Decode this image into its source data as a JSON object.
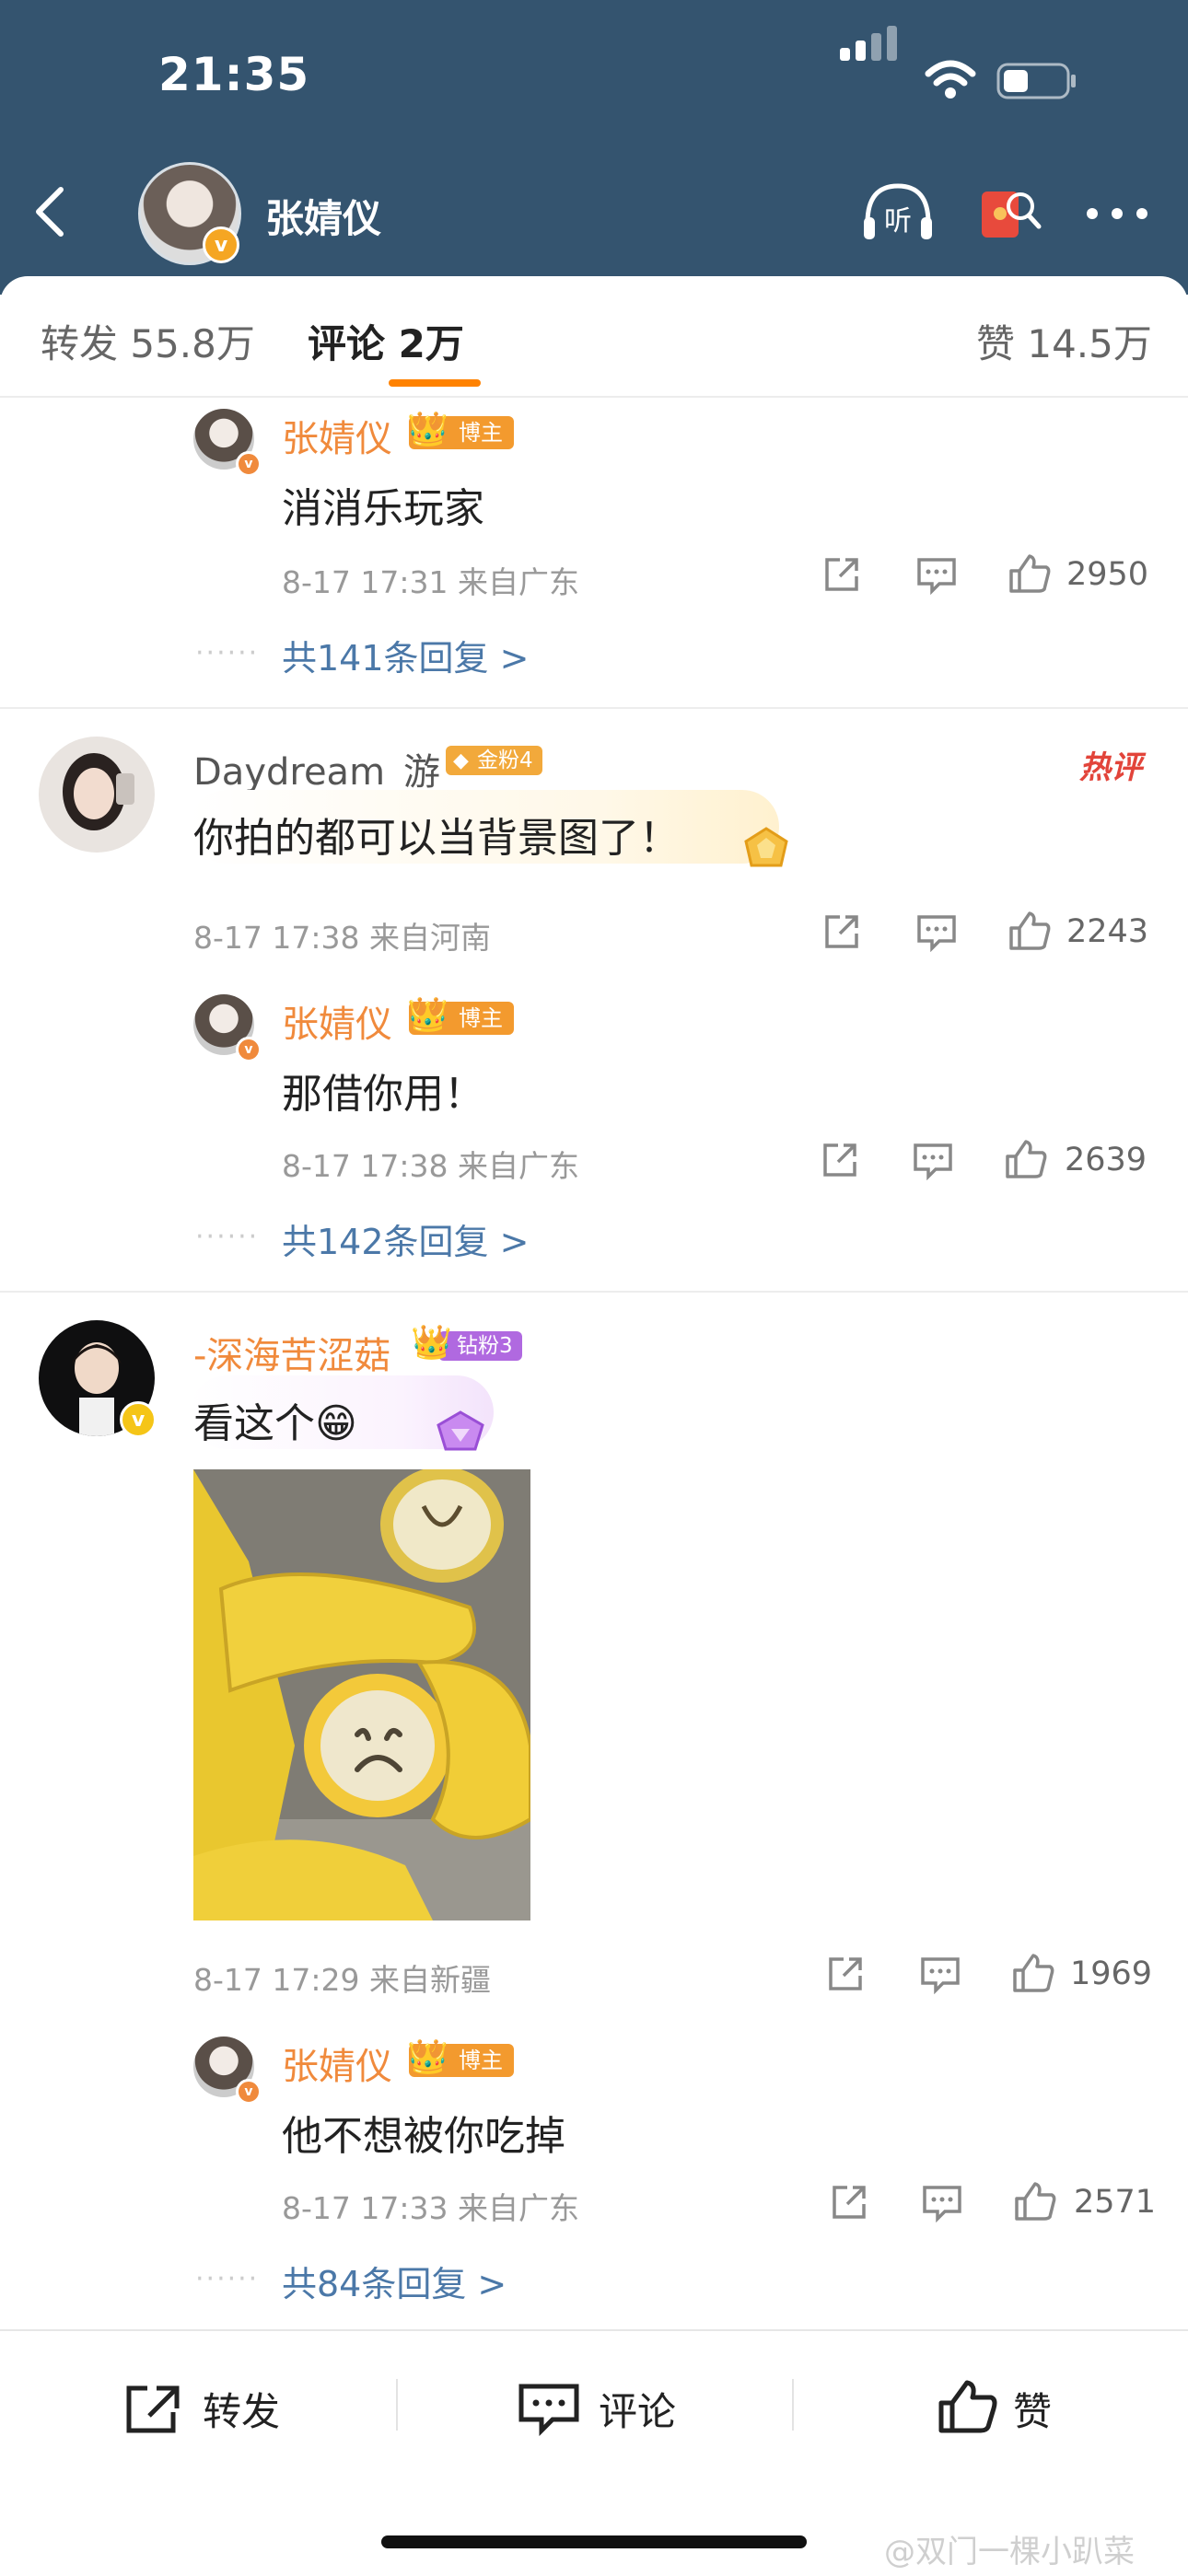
{
  "status_bar": {
    "time": "21:35"
  },
  "header": {
    "name": "张婧仪"
  },
  "tabs": [
    {
      "label": "转发 55.8万"
    },
    {
      "label": "评论 2万"
    },
    {
      "label": "赞 14.5万"
    }
  ],
  "badges": {
    "bozhu": "博主",
    "jinfen4": "金粉4",
    "zuanfen3": "钻粉3",
    "hot": "热评"
  },
  "comments": [
    {
      "reply_name": "张婧仪",
      "reply_text": "消消乐玩家",
      "reply_meta": "8-17 17:31  来自广东",
      "reply_likes": "2950",
      "more_replies": "共141条回复 >"
    },
    {
      "name": "Daydream_游",
      "text": "你拍的都可以当背景图了！",
      "meta": "8-17 17:38  来自河南",
      "likes": "2243",
      "reply_name": "张婧仪",
      "reply_text": "那借你用！",
      "reply_meta": "8-17 17:38  来自广东",
      "reply_likes": "2639",
      "more_replies": "共142条回复 >"
    },
    {
      "name": "-深海苦涩菇",
      "text": "看这个😁",
      "meta": "8-17 17:29  来自新疆",
      "likes": "1969",
      "reply_name": "张婧仪",
      "reply_text": "他不想被你吃掉",
      "reply_meta": "8-17 17:33  来自广东",
      "reply_likes": "2571",
      "more_replies": "共84条回复 >"
    }
  ],
  "bottom_bar": {
    "repost": "转发",
    "comment": "评论",
    "like": "赞"
  },
  "watermark": "@双门一棵小趴菜"
}
